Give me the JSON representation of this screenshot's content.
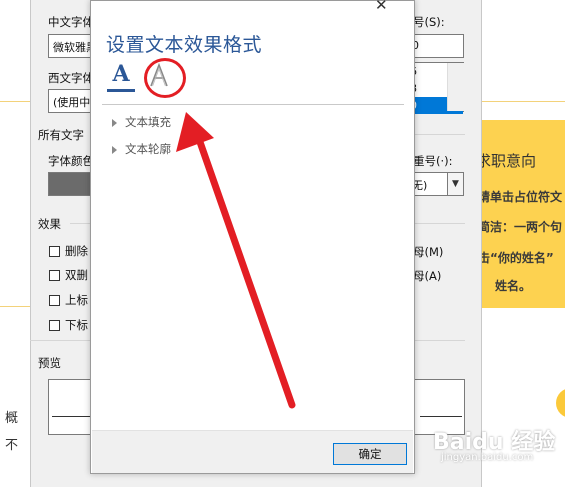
{
  "background_doc": {
    "left_texts": [
      "概",
      "不"
    ],
    "card_title": "求职意向",
    "card_lines": [
      "请单击占位符文",
      "简洁：一两个句",
      "击“你的姓名”",
      "姓名。"
    ],
    "card_color": "#fdd250"
  },
  "font_dialog": {
    "chinese_font_label": "中文字体",
    "chinese_font_value": "微软雅黑",
    "size_label": "号(S):",
    "size_value": "0",
    "size_list": [
      "6",
      "8",
      "0"
    ],
    "western_font_label": "西文字体",
    "western_font_value": "(使用中",
    "all_text_label": "所有文字",
    "font_color_label": "字体颜色",
    "emphasis_label": "重号(·):",
    "emphasis_value": "无)",
    "effects_label": "效果",
    "effects": [
      "删除",
      "双删",
      "上标",
      "下标"
    ],
    "effects_right": [
      "母(M)",
      "母(A)"
    ],
    "preview_label": "预览"
  },
  "text_effects_dialog": {
    "title": "设置文本效果格式",
    "tab_fill_icon": "text-fill-icon",
    "tab_outline_icon": "text-outline-icon",
    "tree_items": [
      "文本填充",
      "文本轮廓"
    ],
    "ok_label": "确定",
    "accent_color": "#2b5797"
  },
  "annotation": {
    "color": "#e31e24"
  },
  "watermark": {
    "main": "Baidu 经验",
    "sub": "jingyan.baidu.com"
  }
}
